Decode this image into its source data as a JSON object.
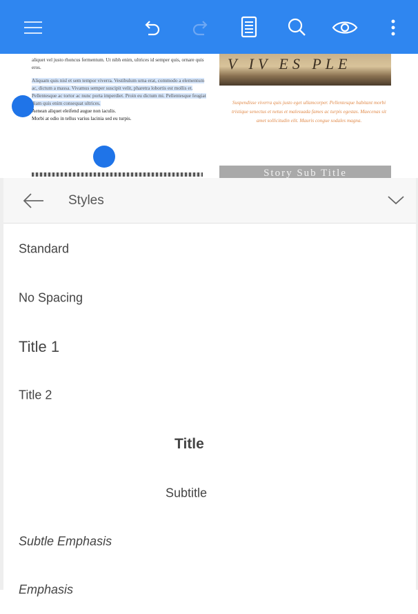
{
  "toolbar": {
    "icons": [
      "menu-icon",
      "undo-icon",
      "redo-icon",
      "document-icon",
      "search-icon",
      "eye-icon",
      "more-icon"
    ],
    "background_color": "#2f86f0"
  },
  "document": {
    "left_para_1": "aliquet vel justo rhoncus fermentum. Ut nibh enim, ultrices id semper quis, ornare quis eros.",
    "left_para_2_selected": "Aliquam quis nisl et sem tempor viverra. Vestibulum urna erat, commodo a elementum ac, dictum a massa. Vivamus semper suscipit velit, pharetra lobortis est mollis et. Pellentesque ac tortor ac nunc porta imperdiet. Proin eu dictum mi. Pellentesque feugiat diam quis enim consequat ultrices.",
    "left_para_2_rest_1": "Aenean aliquet eleifend augue non iaculis.",
    "left_para_2_rest_2": "Morbi at odio in tellus varius lacinia sed eu turpis.",
    "clock_text": "V  IV  ES  PLE",
    "right_orange": "Suspendisse viverra quis justo eget ullamcorper. Pellentesque habitant morbi tristique senectus et netus et malesuada fames ac turpis egestas. Maecenas sit amet sollicitudin elit. Mauris congue sodales magna.",
    "story_sub_title": "Story Sub Title"
  },
  "panel": {
    "title": "Styles",
    "items": [
      {
        "label": "Standard"
      },
      {
        "label": "No Spacing"
      },
      {
        "label": "Title 1"
      },
      {
        "label": "Title 2"
      },
      {
        "label": "Title"
      },
      {
        "label": "Subtitle"
      },
      {
        "label": "Subtle Emphasis"
      },
      {
        "label": "Emphasis"
      }
    ]
  },
  "colors": {
    "accent": "#2f86f0",
    "selection": "#d6e6fb",
    "handle": "#1f74e8",
    "orange_text": "#e08a4a"
  }
}
